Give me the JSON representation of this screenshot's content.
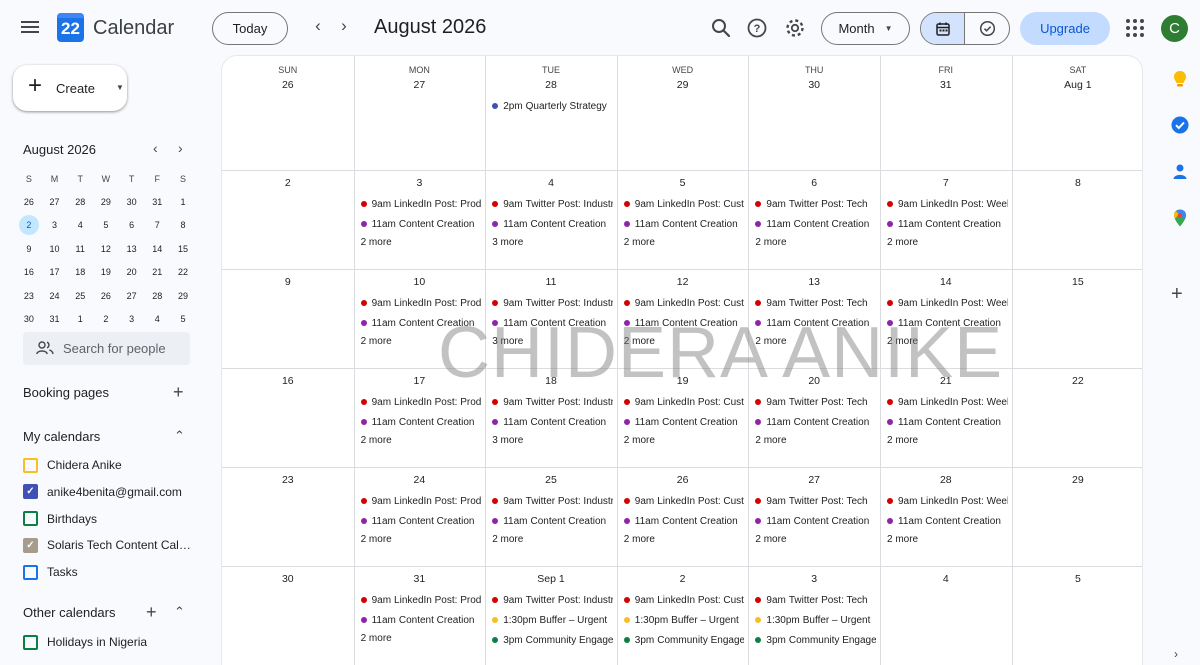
{
  "app": {
    "title": "Calendar",
    "logo_number": "22"
  },
  "header": {
    "today_label": "Today",
    "prev_icon": "chevron-left-icon",
    "next_icon": "chevron-right-icon",
    "period_title": "August 2026",
    "view_label": "Month",
    "upgrade_label": "Upgrade",
    "avatar_initial": "C"
  },
  "sidebar": {
    "create_label": "Create",
    "mini_calendar": {
      "title": "August 2026",
      "weekday_letters": [
        "S",
        "M",
        "T",
        "W",
        "T",
        "F",
        "S"
      ],
      "weeks": [
        [
          "26",
          "27",
          "28",
          "29",
          "30",
          "31",
          "1"
        ],
        [
          "2",
          "3",
          "4",
          "5",
          "6",
          "7",
          "8"
        ],
        [
          "9",
          "10",
          "11",
          "12",
          "13",
          "14",
          "15"
        ],
        [
          "16",
          "17",
          "18",
          "19",
          "20",
          "21",
          "22"
        ],
        [
          "23",
          "24",
          "25",
          "26",
          "27",
          "28",
          "29"
        ],
        [
          "30",
          "31",
          "1",
          "2",
          "3",
          "4",
          "5"
        ]
      ],
      "selected_day": "2"
    },
    "search_placeholder": "Search for people",
    "booking_pages_label": "Booking pages",
    "my_calendars_label": "My calendars",
    "my_calendars": [
      {
        "label": "Chidera Anike",
        "color": "#f6bf26",
        "checked": false
      },
      {
        "label": "anike4benita@gmail.com",
        "color": "#3f51b5",
        "checked": true
      },
      {
        "label": "Birthdays",
        "color": "#0b8043",
        "checked": false
      },
      {
        "label": "Solaris Tech Content Calendar",
        "color": "#a79b8e",
        "checked": true
      },
      {
        "label": "Tasks",
        "color": "#1a73e8",
        "checked": false
      }
    ],
    "other_calendars_label": "Other calendars",
    "other_calendars": [
      {
        "label": "Holidays in Nigeria",
        "color": "#0b8043",
        "checked": false
      }
    ]
  },
  "grid": {
    "weekdays": [
      "SUN",
      "MON",
      "TUE",
      "WED",
      "THU",
      "FRI",
      "SAT"
    ],
    "weeks": [
      [
        {
          "day": "26",
          "events": [],
          "more": ""
        },
        {
          "day": "27",
          "events": [],
          "more": ""
        },
        {
          "day": "28",
          "events": [
            {
              "time": "2pm",
              "title": "Quarterly Strategy",
              "color": "#3f51b5"
            }
          ],
          "more": ""
        },
        {
          "day": "29",
          "events": [],
          "more": ""
        },
        {
          "day": "30",
          "events": [],
          "more": ""
        },
        {
          "day": "31",
          "events": [],
          "more": ""
        },
        {
          "day": "Aug 1",
          "events": [],
          "more": ""
        }
      ],
      [
        {
          "day": "2",
          "events": [],
          "more": ""
        },
        {
          "day": "3",
          "events": [
            {
              "time": "9am",
              "title": "LinkedIn Post: Product",
              "color": "#d50000"
            },
            {
              "time": "11am",
              "title": "Content Creation",
              "color": "#8e24aa"
            }
          ],
          "more": "2 more"
        },
        {
          "day": "4",
          "events": [
            {
              "time": "9am",
              "title": "Twitter Post: Industry",
              "color": "#d50000"
            },
            {
              "time": "11am",
              "title": "Content Creation",
              "color": "#8e24aa"
            }
          ],
          "more": "3 more"
        },
        {
          "day": "5",
          "events": [
            {
              "time": "9am",
              "title": "LinkedIn Post: Customer",
              "color": "#d50000"
            },
            {
              "time": "11am",
              "title": "Content Creation",
              "color": "#8e24aa"
            }
          ],
          "more": "2 more"
        },
        {
          "day": "6",
          "events": [
            {
              "time": "9am",
              "title": "Twitter Post: Tech",
              "color": "#d50000"
            },
            {
              "time": "11am",
              "title": "Content Creation",
              "color": "#8e24aa"
            }
          ],
          "more": "2 more"
        },
        {
          "day": "7",
          "events": [
            {
              "time": "9am",
              "title": "LinkedIn Post: Weekly",
              "color": "#d50000"
            },
            {
              "time": "11am",
              "title": "Content Creation",
              "color": "#8e24aa"
            }
          ],
          "more": "2 more"
        },
        {
          "day": "8",
          "events": [],
          "more": ""
        }
      ],
      [
        {
          "day": "9",
          "events": [],
          "more": ""
        },
        {
          "day": "10",
          "events": [
            {
              "time": "9am",
              "title": "LinkedIn Post: Product",
              "color": "#d50000"
            },
            {
              "time": "11am",
              "title": "Content Creation",
              "color": "#8e24aa"
            }
          ],
          "more": "2 more"
        },
        {
          "day": "11",
          "events": [
            {
              "time": "9am",
              "title": "Twitter Post: Industry",
              "color": "#d50000"
            },
            {
              "time": "11am",
              "title": "Content Creation",
              "color": "#8e24aa"
            }
          ],
          "more": "3 more"
        },
        {
          "day": "12",
          "events": [
            {
              "time": "9am",
              "title": "LinkedIn Post: Customer",
              "color": "#d50000"
            },
            {
              "time": "11am",
              "title": "Content Creation",
              "color": "#8e24aa"
            }
          ],
          "more": "2 more"
        },
        {
          "day": "13",
          "events": [
            {
              "time": "9am",
              "title": "Twitter Post: Tech",
              "color": "#d50000"
            },
            {
              "time": "11am",
              "title": "Content Creation",
              "color": "#8e24aa"
            }
          ],
          "more": "2 more"
        },
        {
          "day": "14",
          "events": [
            {
              "time": "9am",
              "title": "LinkedIn Post: Weekly",
              "color": "#d50000"
            },
            {
              "time": "11am",
              "title": "Content Creation",
              "color": "#8e24aa"
            }
          ],
          "more": "2 more"
        },
        {
          "day": "15",
          "events": [],
          "more": ""
        }
      ],
      [
        {
          "day": "16",
          "events": [],
          "more": ""
        },
        {
          "day": "17",
          "events": [
            {
              "time": "9am",
              "title": "LinkedIn Post: Product",
              "color": "#d50000"
            },
            {
              "time": "11am",
              "title": "Content Creation",
              "color": "#8e24aa"
            }
          ],
          "more": "2 more"
        },
        {
          "day": "18",
          "events": [
            {
              "time": "9am",
              "title": "Twitter Post: Industry",
              "color": "#d50000"
            },
            {
              "time": "11am",
              "title": "Content Creation",
              "color": "#8e24aa"
            }
          ],
          "more": "3 more"
        },
        {
          "day": "19",
          "events": [
            {
              "time": "9am",
              "title": "LinkedIn Post: Customer",
              "color": "#d50000"
            },
            {
              "time": "11am",
              "title": "Content Creation",
              "color": "#8e24aa"
            }
          ],
          "more": "2 more"
        },
        {
          "day": "20",
          "events": [
            {
              "time": "9am",
              "title": "Twitter Post: Tech",
              "color": "#d50000"
            },
            {
              "time": "11am",
              "title": "Content Creation",
              "color": "#8e24aa"
            }
          ],
          "more": "2 more"
        },
        {
          "day": "21",
          "events": [
            {
              "time": "9am",
              "title": "LinkedIn Post: Weekly",
              "color": "#d50000"
            },
            {
              "time": "11am",
              "title": "Content Creation",
              "color": "#8e24aa"
            }
          ],
          "more": "2 more"
        },
        {
          "day": "22",
          "events": [],
          "more": ""
        }
      ],
      [
        {
          "day": "23",
          "events": [],
          "more": ""
        },
        {
          "day": "24",
          "events": [
            {
              "time": "9am",
              "title": "LinkedIn Post: Product",
              "color": "#d50000"
            },
            {
              "time": "11am",
              "title": "Content Creation",
              "color": "#8e24aa"
            }
          ],
          "more": "2 more"
        },
        {
          "day": "25",
          "events": [
            {
              "time": "9am",
              "title": "Twitter Post: Industry",
              "color": "#d50000"
            },
            {
              "time": "11am",
              "title": "Content Creation",
              "color": "#8e24aa"
            }
          ],
          "more": "2 more"
        },
        {
          "day": "26",
          "events": [
            {
              "time": "9am",
              "title": "LinkedIn Post: Customer",
              "color": "#d50000"
            },
            {
              "time": "11am",
              "title": "Content Creation",
              "color": "#8e24aa"
            }
          ],
          "more": "2 more"
        },
        {
          "day": "27",
          "events": [
            {
              "time": "9am",
              "title": "Twitter Post: Tech",
              "color": "#d50000"
            },
            {
              "time": "11am",
              "title": "Content Creation",
              "color": "#8e24aa"
            }
          ],
          "more": "2 more"
        },
        {
          "day": "28",
          "events": [
            {
              "time": "9am",
              "title": "LinkedIn Post: Weekly",
              "color": "#d50000"
            },
            {
              "time": "11am",
              "title": "Content Creation",
              "color": "#8e24aa"
            }
          ],
          "more": "2 more"
        },
        {
          "day": "29",
          "events": [],
          "more": ""
        }
      ],
      [
        {
          "day": "30",
          "events": [],
          "more": ""
        },
        {
          "day": "31",
          "events": [
            {
              "time": "9am",
              "title": "LinkedIn Post: Product",
              "color": "#d50000"
            },
            {
              "time": "11am",
              "title": "Content Creation",
              "color": "#8e24aa"
            }
          ],
          "more": "2 more"
        },
        {
          "day": "Sep 1",
          "events": [
            {
              "time": "9am",
              "title": "Twitter Post: Industry",
              "color": "#d50000"
            },
            {
              "time": "1:30pm",
              "title": "Buffer – Urgent",
              "color": "#f6bf26"
            },
            {
              "time": "3pm",
              "title": "Community Engagement",
              "color": "#0b8043"
            }
          ],
          "more": ""
        },
        {
          "day": "2",
          "events": [
            {
              "time": "9am",
              "title": "LinkedIn Post: Customer",
              "color": "#d50000"
            },
            {
              "time": "1:30pm",
              "title": "Buffer – Urgent",
              "color": "#f6bf26"
            },
            {
              "time": "3pm",
              "title": "Community Engagement",
              "color": "#0b8043"
            }
          ],
          "more": ""
        },
        {
          "day": "3",
          "events": [
            {
              "time": "9am",
              "title": "Twitter Post: Tech",
              "color": "#d50000"
            },
            {
              "time": "1:30pm",
              "title": "Buffer – Urgent",
              "color": "#f6bf26"
            },
            {
              "time": "3pm",
              "title": "Community Engagement",
              "color": "#0b8043"
            }
          ],
          "more": ""
        },
        {
          "day": "4",
          "events": [],
          "more": ""
        },
        {
          "day": "5",
          "events": [],
          "more": ""
        }
      ]
    ]
  },
  "watermark": "CHIDERA ANIKE",
  "right_rail": {
    "icons": [
      "keep-icon",
      "tasks-icon",
      "contacts-icon",
      "maps-icon"
    ],
    "add_icon": "plus-icon"
  }
}
